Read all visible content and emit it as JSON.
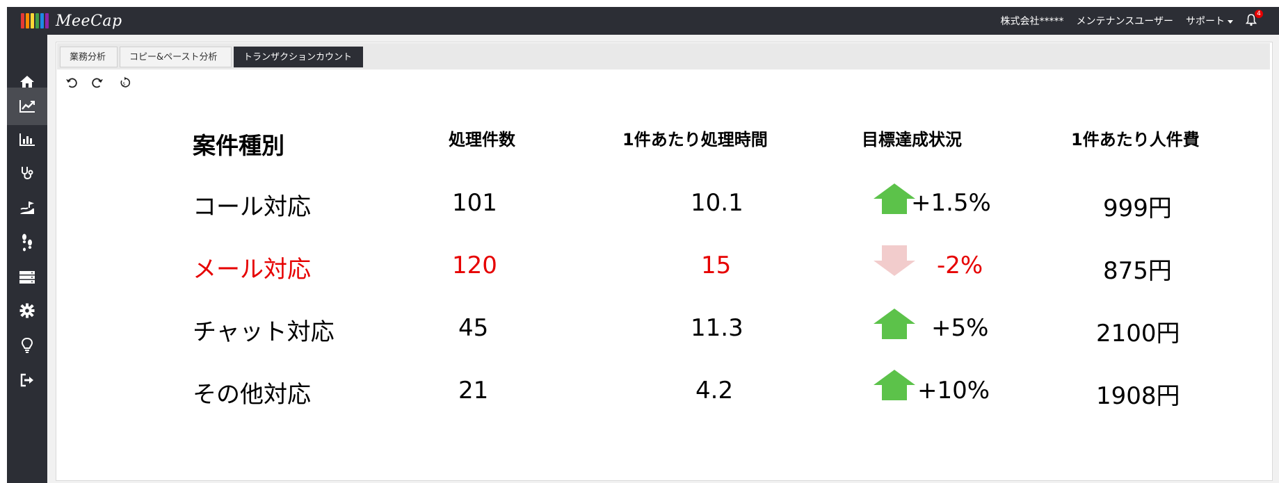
{
  "app": {
    "name": "MeeCap"
  },
  "topbar": {
    "company": "株式会社*****",
    "user": "メンテナンスユーザー",
    "support": "サポート",
    "notification_count": "4"
  },
  "sidebar": {
    "items": [
      {
        "icon": "home-icon"
      },
      {
        "icon": "line-chart-icon",
        "active": true
      },
      {
        "icon": "bar-chart-icon"
      },
      {
        "icon": "stethoscope-icon"
      },
      {
        "icon": "road-flag-icon"
      },
      {
        "icon": "footprints-icon"
      },
      {
        "icon": "server-icon"
      },
      {
        "icon": "gear-icon"
      },
      {
        "icon": "lightbulb-icon"
      },
      {
        "icon": "sign-out-icon"
      }
    ]
  },
  "tabs": [
    {
      "label": "業務分析"
    },
    {
      "label": "コピー&ペースト分析"
    },
    {
      "label": "トランザクションカウント",
      "active": true
    }
  ],
  "toolbar": {
    "icons": [
      "undo-icon",
      "redo-icon",
      "reset-icon"
    ]
  },
  "table": {
    "headers": [
      "案件種別",
      "処理件数",
      "1件あたり処理時間",
      "目標達成状況",
      "1件あたり人件費"
    ],
    "rows": [
      {
        "type": "コール対応",
        "count": "101",
        "time": "10.1",
        "trend": "up",
        "change": "+1.5%",
        "cost": "999円",
        "highlight": false
      },
      {
        "type": "メール対応",
        "count": "120",
        "time": "15",
        "trend": "down",
        "change": "-2%",
        "cost": "875円",
        "highlight": true
      },
      {
        "type": "チャット対応",
        "count": "45",
        "time": "11.3",
        "trend": "up",
        "change": "+5%",
        "cost": "2100円",
        "highlight": false
      },
      {
        "type": "その他対応",
        "count": "21",
        "time": "4.2",
        "trend": "up",
        "change": "+10%",
        "cost": "1908円",
        "highlight": false
      }
    ]
  },
  "colors": {
    "header_bg": "#2c2e35",
    "highlight_text": "#e60000",
    "up_arrow": "#5cc24a",
    "down_arrow": "#f2cccc"
  }
}
